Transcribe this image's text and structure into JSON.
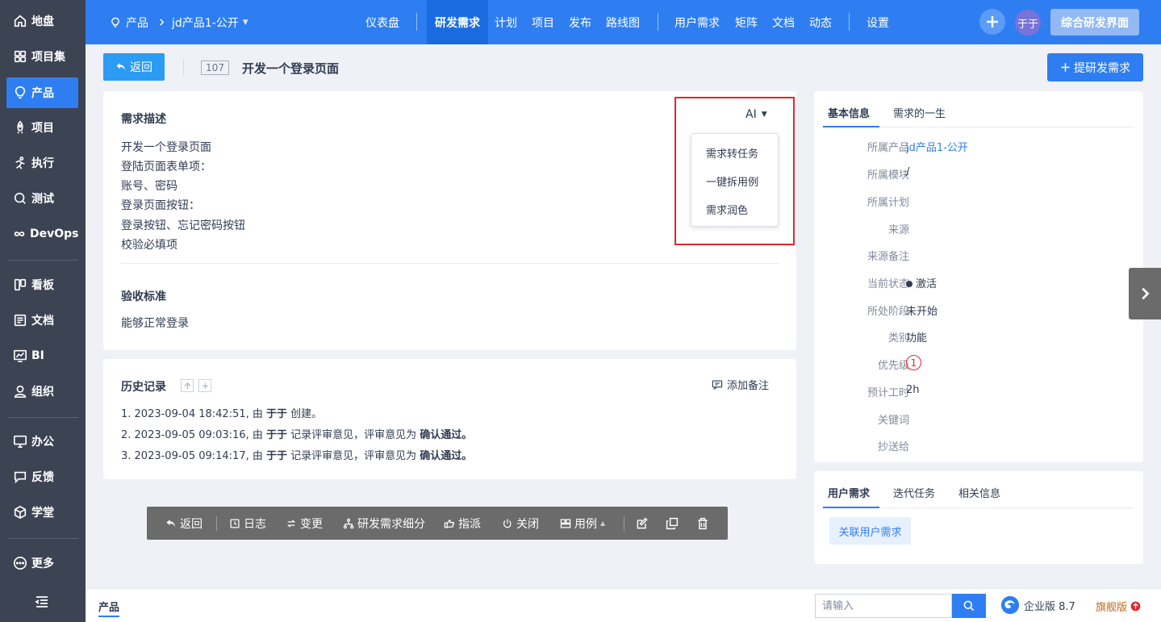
{
  "sidebar": {
    "items": [
      {
        "label": "地盘",
        "icon": "home-icon"
      },
      {
        "label": "项目集",
        "icon": "grid-icon"
      },
      {
        "label": "产品",
        "icon": "lightbulb-icon"
      },
      {
        "label": "项目",
        "icon": "rocket-icon"
      },
      {
        "label": "执行",
        "icon": "run-icon"
      },
      {
        "label": "测试",
        "icon": "test-icon"
      },
      {
        "label": "DevOps",
        "icon": "infinity-icon"
      },
      {
        "label": "看板",
        "icon": "kanban-icon"
      },
      {
        "label": "文档",
        "icon": "doc-icon"
      },
      {
        "label": "BI",
        "icon": "bi-icon"
      },
      {
        "label": "组织",
        "icon": "user-icon"
      },
      {
        "label": "办公",
        "icon": "oa-icon"
      },
      {
        "label": "反馈",
        "icon": "feedback-icon"
      },
      {
        "label": "学堂",
        "icon": "cube-icon"
      },
      {
        "label": "更多",
        "icon": "more-icon"
      }
    ],
    "active_index": 2
  },
  "topbar": {
    "crumb_product": "产品",
    "crumb_current": "jd产品1-公开",
    "nav": [
      "仪表盘",
      "研发需求",
      "计划",
      "项目",
      "发布",
      "路线图",
      "用户需求",
      "矩阵",
      "文档",
      "动态",
      "设置"
    ],
    "active_nav": "研发需求",
    "avatar": "于于",
    "mode_button": "综合研发界面"
  },
  "story": {
    "back_label": "返回",
    "id": "107",
    "title": "开发一个登录页面",
    "create_label": "提研发需求"
  },
  "description": {
    "title": "需求描述",
    "lines": [
      "开发一个登录页面",
      "登陆页面表单项：",
      "账号、密码",
      "登录页面按钮：",
      "登录按钮、忘记密码按钮",
      "校验必填项"
    ],
    "acceptance_title": "验收标准",
    "acceptance_text": "能够正常登录"
  },
  "ai_menu": {
    "toggle": "AI",
    "items": [
      "需求转任务",
      "一键拆用例",
      "需求润色"
    ]
  },
  "history": {
    "title": "历史记录",
    "add_note": "添加备注",
    "entries": [
      {
        "prefix": "1. 2023-09-04 18:42:51, 由 ",
        "user": "于于",
        "suffix": " 创建。",
        "result": ""
      },
      {
        "prefix": "2. 2023-09-05 09:03:16, 由 ",
        "user": "于于",
        "suffix": " 记录评审意见，评审意见为 ",
        "result": "确认通过。"
      },
      {
        "prefix": "3. 2023-09-05 09:14:17, 由 ",
        "user": "于于",
        "suffix": " 记录评审意见，评审意见为 ",
        "result": "确认通过。"
      }
    ]
  },
  "toolbar": {
    "items": [
      "返回",
      "日志",
      "变更",
      "研发需求细分",
      "指派",
      "关闭",
      "用例"
    ]
  },
  "info_panel": {
    "tabs": [
      "基本信息",
      "需求的一生"
    ],
    "rows": [
      {
        "label": "所属产品",
        "value": "jd产品1-公开",
        "link": true
      },
      {
        "label": "所属模块",
        "value": "/"
      },
      {
        "label": "所属计划",
        "value": ""
      },
      {
        "label": "来源",
        "value": ""
      },
      {
        "label": "来源备注",
        "value": ""
      },
      {
        "label": "当前状态",
        "value": "激活"
      },
      {
        "label": "所处阶段",
        "value": "未开始"
      },
      {
        "label": "类别",
        "value": "功能"
      },
      {
        "label": "优先级",
        "value": "1"
      },
      {
        "label": "预计工时",
        "value": "2h"
      },
      {
        "label": "关键词",
        "value": ""
      },
      {
        "label": "抄送给",
        "value": ""
      }
    ]
  },
  "related_panel": {
    "tabs": [
      "用户需求",
      "迭代任务",
      "相关信息"
    ],
    "link_button": "关联用户需求"
  },
  "footer": {
    "tab": "产品",
    "search_placeholder": "请输入",
    "edition": "企业版 8.7",
    "upgrade": "旗舰版"
  }
}
